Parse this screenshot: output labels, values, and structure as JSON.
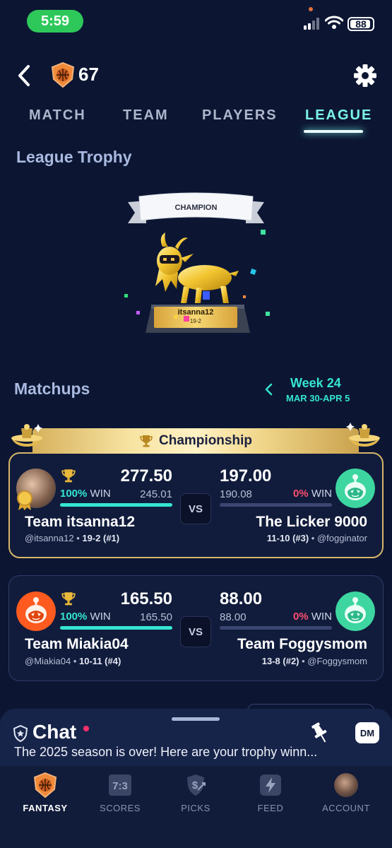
{
  "status_bar": {
    "time": "5:59",
    "battery": "88"
  },
  "header": {
    "level": "67"
  },
  "tabs": [
    {
      "label": "MATCH",
      "active": false
    },
    {
      "label": "TEAM",
      "active": false
    },
    {
      "label": "PLAYERS",
      "active": false
    },
    {
      "label": "LEAGUE",
      "active": true
    }
  ],
  "trophy": {
    "title": "League Trophy",
    "ribbon": "CHAMPION",
    "plaque_name": "itsanna12",
    "plaque_record": "19-2"
  },
  "matchups": {
    "title": "Matchups",
    "week": "Week 24",
    "dates": "MAR 30-APR 5",
    "vs_label": "VS",
    "championship_label": "Championship",
    "games": [
      {
        "left": {
          "score": "277.50",
          "projected": "245.01",
          "win_pct": "100%",
          "win_word": "WIN",
          "team": "Team itsanna12",
          "handle": "@itsanna12",
          "record": "19-2 (#1)"
        },
        "right": {
          "score": "197.00",
          "projected": "190.08",
          "win_pct": "0%",
          "win_word": "WIN",
          "team": "The Licker 9000",
          "handle": "@fogginator",
          "record": "11-10 (#3)"
        }
      },
      {
        "left": {
          "score": "165.50",
          "projected": "165.50",
          "win_pct": "100%",
          "win_word": "WIN",
          "team": "Team Miakia04",
          "handle": "@Miakia04",
          "record": "10-11 (#4)"
        },
        "right": {
          "score": "88.00",
          "projected": "88.00",
          "win_pct": "0%",
          "win_word": "WIN",
          "team": "Team Foggysmom",
          "handle": "@Foggysmom",
          "record": "13-8 (#2)"
        }
      }
    ]
  },
  "chat": {
    "title": "Chat",
    "dm_label": "DM",
    "preview": "The 2025 season is over!  Here are your trophy winn..."
  },
  "bottom_nav": [
    {
      "label": "FANTASY",
      "icon": "basketball-shield-icon",
      "active": true
    },
    {
      "label": "SCORES",
      "icon": "scoreboard-icon",
      "active": false
    },
    {
      "label": "PICKS",
      "icon": "picks-icon",
      "active": false
    },
    {
      "label": "FEED",
      "icon": "lightning-icon",
      "active": false
    },
    {
      "label": "ACCOUNT",
      "icon": "profile-avatar-icon",
      "active": false
    }
  ],
  "colors": {
    "background": "#0c1633",
    "accent_teal": "#35e6d2",
    "loss_red": "#ff4d6d",
    "gold": "#d8b66a"
  }
}
